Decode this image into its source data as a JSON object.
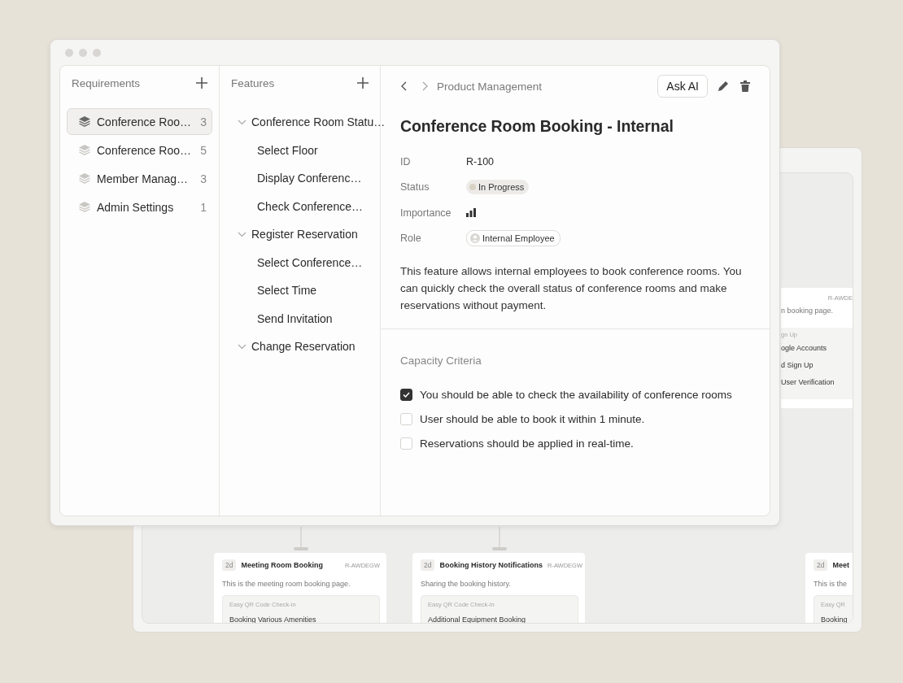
{
  "front_window": {
    "requirements": {
      "title": "Requirements",
      "items": [
        {
          "label": "Conference Roo…",
          "count": "3",
          "selected": true
        },
        {
          "label": "Conference Roo…",
          "count": "5",
          "selected": false
        },
        {
          "label": "Member Manag…",
          "count": "3",
          "selected": false
        },
        {
          "label": "Admin Settings",
          "count": "1",
          "selected": false
        }
      ]
    },
    "features": {
      "title": "Features",
      "items": [
        {
          "label": "Conference Room Statu…",
          "expanded": true,
          "children": [
            {
              "label": "Select Floor"
            },
            {
              "label": "Display Conferenc…"
            },
            {
              "label": "Check Conference…"
            }
          ]
        },
        {
          "label": "Register Reservation",
          "expanded": true,
          "children": [
            {
              "label": "Select Conference…"
            },
            {
              "label": "Select Time"
            },
            {
              "label": "Send Invitation"
            }
          ]
        },
        {
          "label": "Change Reservation",
          "expanded": true
        }
      ]
    },
    "detail": {
      "breadcrumb": "Product Management",
      "ask_ai": "Ask AI",
      "title": "Conference Room Booking - Internal",
      "fields": [
        {
          "kind": "text",
          "label": "ID",
          "value": "R-100"
        },
        {
          "kind": "status",
          "label": "Status",
          "value": "In Progress"
        },
        {
          "kind": "bars",
          "label": "Importance"
        },
        {
          "kind": "role",
          "label": "Role",
          "value": "Internal Employee"
        }
      ],
      "description": "This feature allows internal employees to book conference rooms. You can quickly check the overall status of conference rooms and make reservations without payment.",
      "criteria": {
        "title": "Capacity Criteria",
        "items": [
          {
            "label": "You should be able to check the availability of conference rooms",
            "checked": true
          },
          {
            "label": "User should be able to book it within 1 minute.",
            "checked": false
          },
          {
            "label": "Reservations should be applied in real-time.",
            "checked": false
          }
        ]
      }
    }
  },
  "back_window": {
    "side_card": {
      "code": "R-AWDE",
      "description": "n booking page.",
      "sub_title": "gn Up",
      "sub_items": [
        "ogle Accounts",
        "d Sign Up",
        "User Verification"
      ]
    },
    "cards": [
      {
        "badge": "2d",
        "title": "Meeting Room Booking",
        "code": "R-AWDEGW",
        "description": "This is the meeting room booking page.",
        "sub_title": "Easy QR Code Check-in",
        "sub_item": "Booking Various Amenities"
      },
      {
        "badge": "2d",
        "title": "Booking History Notifications",
        "code": "R-AWDEGW",
        "description": "Sharing the booking history.",
        "sub_title": "Easy QR Code Check-in",
        "sub_item": "Additional Equipment Booking"
      },
      {
        "badge": "2d",
        "title": "Meet",
        "description": "This is the",
        "sub_title": "Easy QR",
        "sub_item": "Booking"
      }
    ]
  }
}
